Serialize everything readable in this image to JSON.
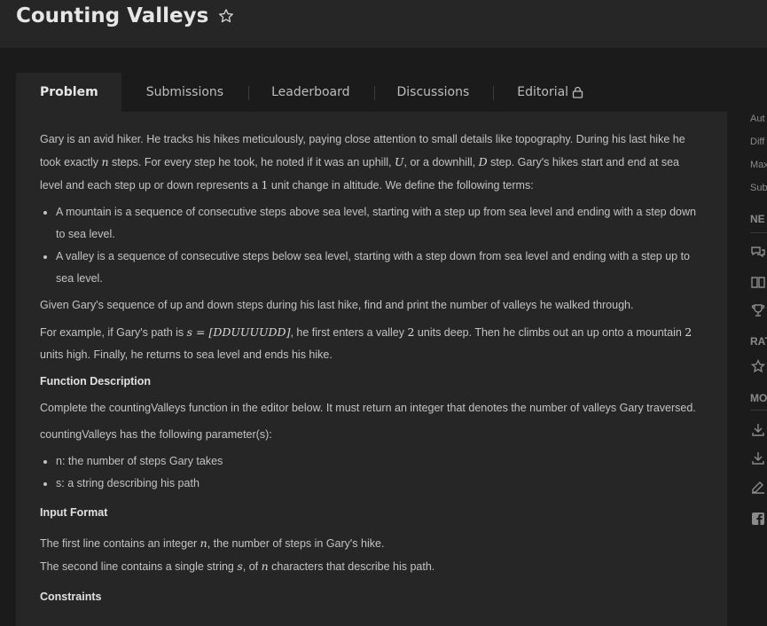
{
  "header": {
    "title": "Counting Valleys"
  },
  "tabs": [
    {
      "label": "Problem"
    },
    {
      "label": "Submissions"
    },
    {
      "label": "Leaderboard"
    },
    {
      "label": "Discussions"
    },
    {
      "label": "Editorial"
    }
  ],
  "problem": {
    "intro_1": "Gary is an avid hiker. He tracks his hikes meticulously, paying close attention to small details like topography. During his last hike he took exactly ",
    "intro_n": "n",
    "intro_2": " steps. For every step he took, he noted if it was an uphill, ",
    "intro_U": "U",
    "intro_3": ", or a downhill, ",
    "intro_D": "D",
    "intro_4": " step. Gary's hikes start and end at sea level and each step up or down represents a ",
    "intro_1unit": "1",
    "intro_5": " unit change in altitude. We define the following terms:",
    "bullet_mountain": "A mountain is a sequence of consecutive steps above sea level, starting with a step up from sea level and ending with a step down to sea level.",
    "bullet_valley": "A valley is a sequence of consecutive steps below sea level, starting with a step down from sea level and ending with a step up to sea level.",
    "given": "Given Gary's sequence of up and down steps during his last hike, find and print the number of valleys he walked through.",
    "example_1": "For example, if Gary's path is ",
    "example_path": "s = [DDUUUUDD]",
    "example_2": ", he first enters a valley ",
    "example_2num": "2",
    "example_3": " units deep. Then he climbs out an up onto a mountain ",
    "example_3num": "2",
    "example_4": " units high. Finally, he returns to sea level and ends his hike.",
    "function_heading": "Function Description",
    "function_desc": "Complete the countingValleys function in the editor below. It must return an integer that denotes the number of valleys Gary traversed.",
    "params_intro": "countingValleys has the following parameter(s):",
    "param_n": "n: the number of steps Gary takes",
    "param_s": "s: a string describing his path",
    "input_heading": "Input Format",
    "input_1a": "The first line contains an integer ",
    "input_1n": "n",
    "input_1b": ", the number of steps in Gary's hike.",
    "input_2a": "The second line contains a single string ",
    "input_2s": "s",
    "input_2b": ", of ",
    "input_2n": "n",
    "input_2c": " characters that describe his path.",
    "constraints_heading": "Constraints"
  },
  "sidebar": {
    "meta": [
      "Aut",
      "Diff",
      "Max",
      "Sub"
    ],
    "section_1": "NE",
    "section_2": "RAT",
    "section_3": "MO",
    "icons": [
      "discussion-icon",
      "book-icon",
      "trophy-icon",
      "star-icon",
      "download-icon",
      "download-icon",
      "edit-icon",
      "facebook-icon"
    ]
  }
}
